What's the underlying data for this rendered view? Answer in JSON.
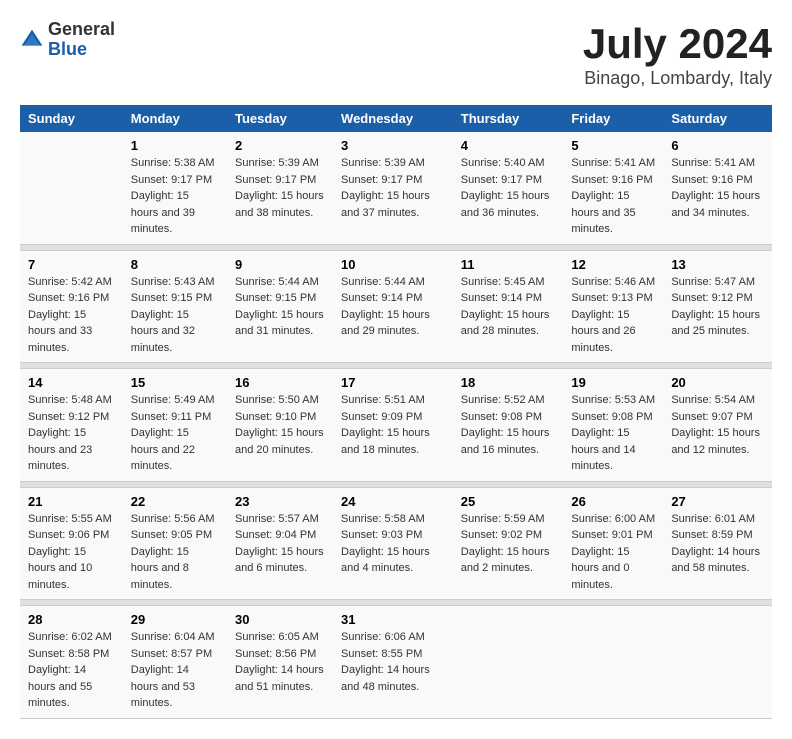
{
  "header": {
    "logo_general": "General",
    "logo_blue": "Blue",
    "title": "July 2024",
    "subtitle": "Binago, Lombardy, Italy"
  },
  "days_of_week": [
    "Sunday",
    "Monday",
    "Tuesday",
    "Wednesday",
    "Thursday",
    "Friday",
    "Saturday"
  ],
  "weeks": [
    {
      "days": [
        {
          "num": "",
          "sunrise": "",
          "sunset": "",
          "daylight": ""
        },
        {
          "num": "1",
          "sunrise": "Sunrise: 5:38 AM",
          "sunset": "Sunset: 9:17 PM",
          "daylight": "Daylight: 15 hours and 39 minutes."
        },
        {
          "num": "2",
          "sunrise": "Sunrise: 5:39 AM",
          "sunset": "Sunset: 9:17 PM",
          "daylight": "Daylight: 15 hours and 38 minutes."
        },
        {
          "num": "3",
          "sunrise": "Sunrise: 5:39 AM",
          "sunset": "Sunset: 9:17 PM",
          "daylight": "Daylight: 15 hours and 37 minutes."
        },
        {
          "num": "4",
          "sunrise": "Sunrise: 5:40 AM",
          "sunset": "Sunset: 9:17 PM",
          "daylight": "Daylight: 15 hours and 36 minutes."
        },
        {
          "num": "5",
          "sunrise": "Sunrise: 5:41 AM",
          "sunset": "Sunset: 9:16 PM",
          "daylight": "Daylight: 15 hours and 35 minutes."
        },
        {
          "num": "6",
          "sunrise": "Sunrise: 5:41 AM",
          "sunset": "Sunset: 9:16 PM",
          "daylight": "Daylight: 15 hours and 34 minutes."
        }
      ]
    },
    {
      "days": [
        {
          "num": "7",
          "sunrise": "Sunrise: 5:42 AM",
          "sunset": "Sunset: 9:16 PM",
          "daylight": "Daylight: 15 hours and 33 minutes."
        },
        {
          "num": "8",
          "sunrise": "Sunrise: 5:43 AM",
          "sunset": "Sunset: 9:15 PM",
          "daylight": "Daylight: 15 hours and 32 minutes."
        },
        {
          "num": "9",
          "sunrise": "Sunrise: 5:44 AM",
          "sunset": "Sunset: 9:15 PM",
          "daylight": "Daylight: 15 hours and 31 minutes."
        },
        {
          "num": "10",
          "sunrise": "Sunrise: 5:44 AM",
          "sunset": "Sunset: 9:14 PM",
          "daylight": "Daylight: 15 hours and 29 minutes."
        },
        {
          "num": "11",
          "sunrise": "Sunrise: 5:45 AM",
          "sunset": "Sunset: 9:14 PM",
          "daylight": "Daylight: 15 hours and 28 minutes."
        },
        {
          "num": "12",
          "sunrise": "Sunrise: 5:46 AM",
          "sunset": "Sunset: 9:13 PM",
          "daylight": "Daylight: 15 hours and 26 minutes."
        },
        {
          "num": "13",
          "sunrise": "Sunrise: 5:47 AM",
          "sunset": "Sunset: 9:12 PM",
          "daylight": "Daylight: 15 hours and 25 minutes."
        }
      ]
    },
    {
      "days": [
        {
          "num": "14",
          "sunrise": "Sunrise: 5:48 AM",
          "sunset": "Sunset: 9:12 PM",
          "daylight": "Daylight: 15 hours and 23 minutes."
        },
        {
          "num": "15",
          "sunrise": "Sunrise: 5:49 AM",
          "sunset": "Sunset: 9:11 PM",
          "daylight": "Daylight: 15 hours and 22 minutes."
        },
        {
          "num": "16",
          "sunrise": "Sunrise: 5:50 AM",
          "sunset": "Sunset: 9:10 PM",
          "daylight": "Daylight: 15 hours and 20 minutes."
        },
        {
          "num": "17",
          "sunrise": "Sunrise: 5:51 AM",
          "sunset": "Sunset: 9:09 PM",
          "daylight": "Daylight: 15 hours and 18 minutes."
        },
        {
          "num": "18",
          "sunrise": "Sunrise: 5:52 AM",
          "sunset": "Sunset: 9:08 PM",
          "daylight": "Daylight: 15 hours and 16 minutes."
        },
        {
          "num": "19",
          "sunrise": "Sunrise: 5:53 AM",
          "sunset": "Sunset: 9:08 PM",
          "daylight": "Daylight: 15 hours and 14 minutes."
        },
        {
          "num": "20",
          "sunrise": "Sunrise: 5:54 AM",
          "sunset": "Sunset: 9:07 PM",
          "daylight": "Daylight: 15 hours and 12 minutes."
        }
      ]
    },
    {
      "days": [
        {
          "num": "21",
          "sunrise": "Sunrise: 5:55 AM",
          "sunset": "Sunset: 9:06 PM",
          "daylight": "Daylight: 15 hours and 10 minutes."
        },
        {
          "num": "22",
          "sunrise": "Sunrise: 5:56 AM",
          "sunset": "Sunset: 9:05 PM",
          "daylight": "Daylight: 15 hours and 8 minutes."
        },
        {
          "num": "23",
          "sunrise": "Sunrise: 5:57 AM",
          "sunset": "Sunset: 9:04 PM",
          "daylight": "Daylight: 15 hours and 6 minutes."
        },
        {
          "num": "24",
          "sunrise": "Sunrise: 5:58 AM",
          "sunset": "Sunset: 9:03 PM",
          "daylight": "Daylight: 15 hours and 4 minutes."
        },
        {
          "num": "25",
          "sunrise": "Sunrise: 5:59 AM",
          "sunset": "Sunset: 9:02 PM",
          "daylight": "Daylight: 15 hours and 2 minutes."
        },
        {
          "num": "26",
          "sunrise": "Sunrise: 6:00 AM",
          "sunset": "Sunset: 9:01 PM",
          "daylight": "Daylight: 15 hours and 0 minutes."
        },
        {
          "num": "27",
          "sunrise": "Sunrise: 6:01 AM",
          "sunset": "Sunset: 8:59 PM",
          "daylight": "Daylight: 14 hours and 58 minutes."
        }
      ]
    },
    {
      "days": [
        {
          "num": "28",
          "sunrise": "Sunrise: 6:02 AM",
          "sunset": "Sunset: 8:58 PM",
          "daylight": "Daylight: 14 hours and 55 minutes."
        },
        {
          "num": "29",
          "sunrise": "Sunrise: 6:04 AM",
          "sunset": "Sunset: 8:57 PM",
          "daylight": "Daylight: 14 hours and 53 minutes."
        },
        {
          "num": "30",
          "sunrise": "Sunrise: 6:05 AM",
          "sunset": "Sunset: 8:56 PM",
          "daylight": "Daylight: 14 hours and 51 minutes."
        },
        {
          "num": "31",
          "sunrise": "Sunrise: 6:06 AM",
          "sunset": "Sunset: 8:55 PM",
          "daylight": "Daylight: 14 hours and 48 minutes."
        },
        {
          "num": "",
          "sunrise": "",
          "sunset": "",
          "daylight": ""
        },
        {
          "num": "",
          "sunrise": "",
          "sunset": "",
          "daylight": ""
        },
        {
          "num": "",
          "sunrise": "",
          "sunset": "",
          "daylight": ""
        }
      ]
    }
  ]
}
